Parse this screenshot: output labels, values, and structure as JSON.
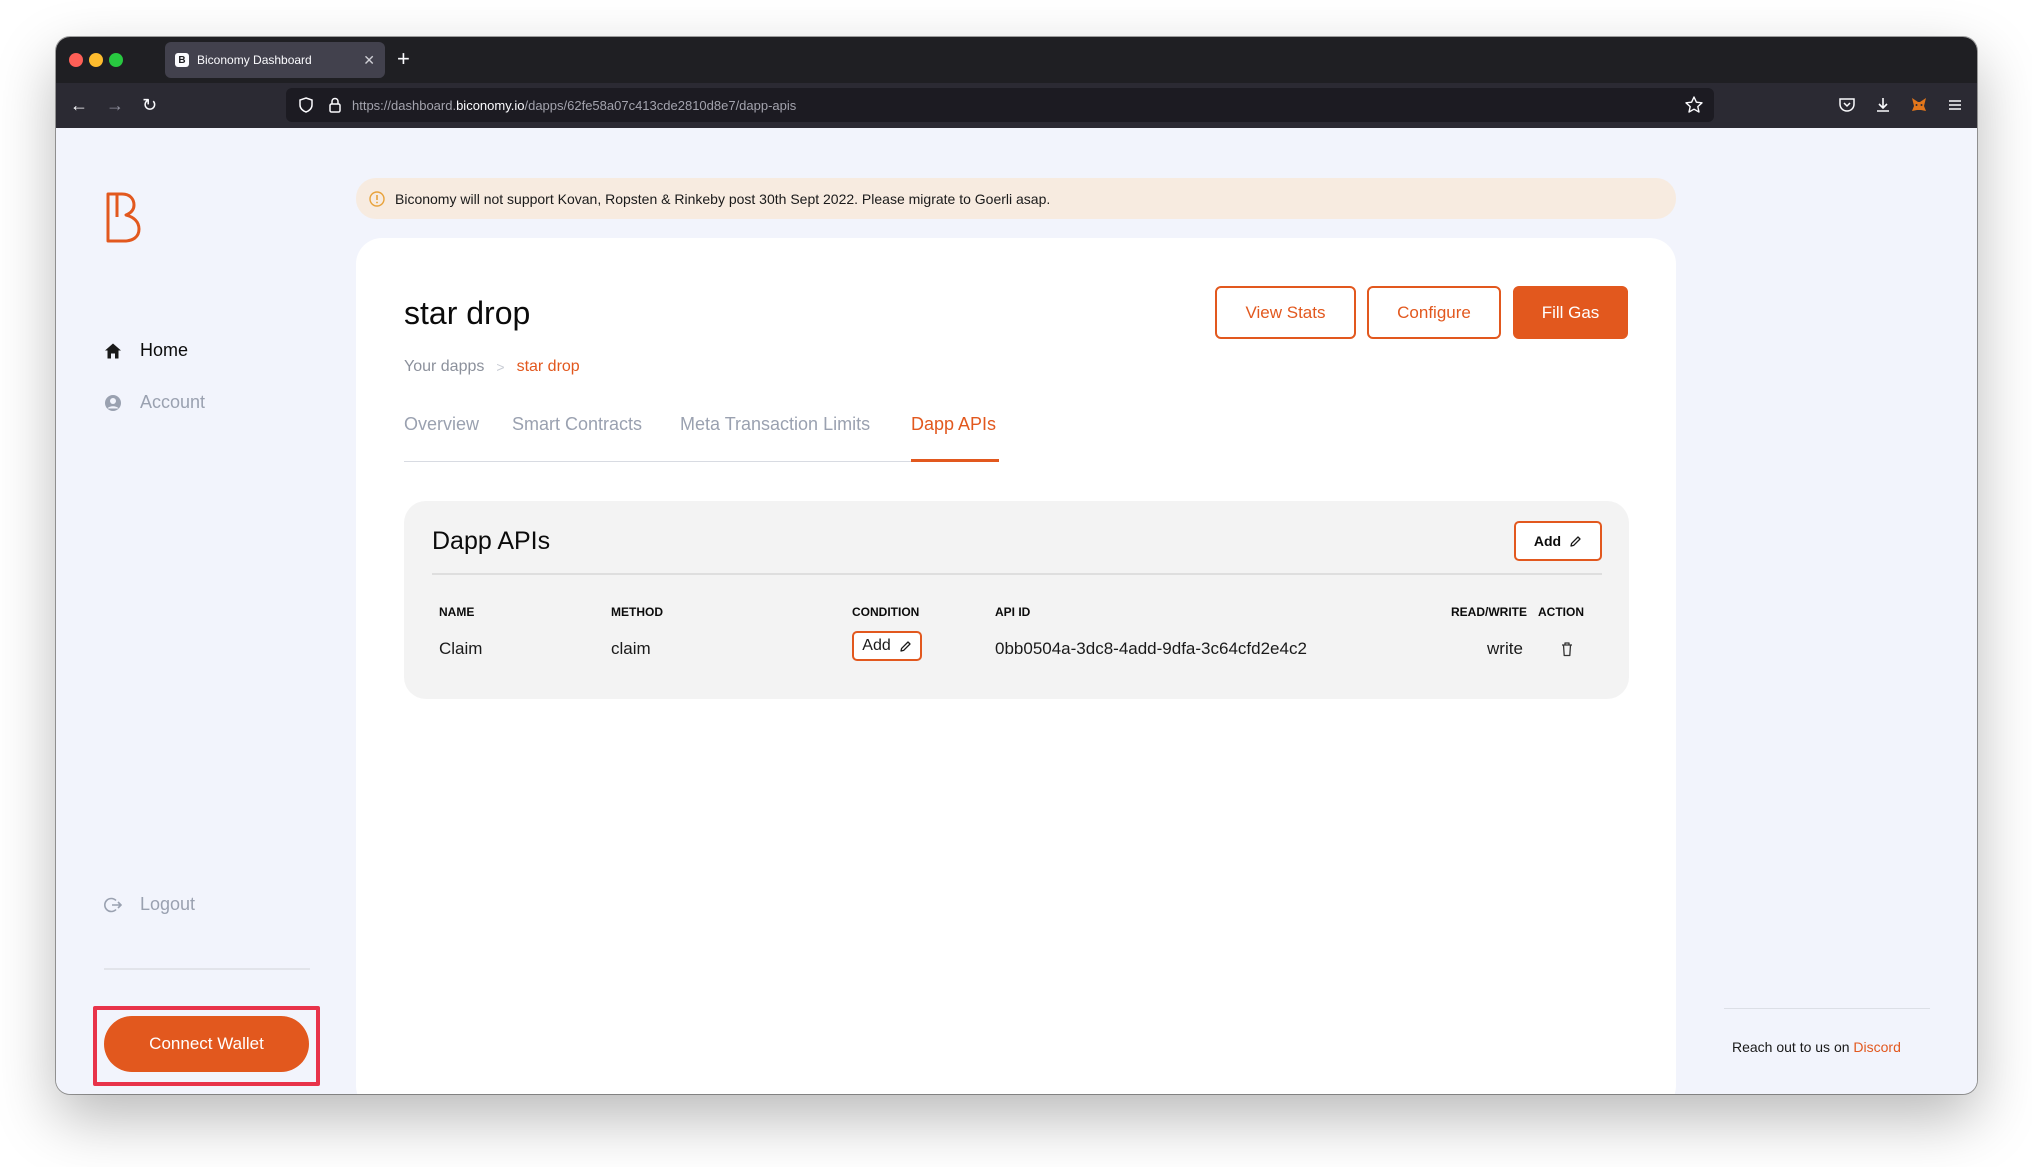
{
  "browser": {
    "tab_title": "Biconomy Dashboard",
    "tab_favicon": "B",
    "new_tab": "+",
    "url_prefix": "https://dashboard.",
    "url_domain": "biconomy.io",
    "url_path": "/dapps/62fe58a07c413cde2810d8e7/dapp-apis"
  },
  "sidebar": {
    "items": [
      {
        "label": "Home",
        "icon": "home-icon"
      },
      {
        "label": "Account",
        "icon": "account-icon"
      }
    ],
    "logout_label": "Logout",
    "connect_wallet_label": "Connect Wallet"
  },
  "banner": {
    "text": "Biconomy will not support Kovan, Ropsten & Rinkeby post 30th Sept 2022. Please migrate to Goerli asap."
  },
  "page": {
    "title": "star drop",
    "breadcrumb": {
      "root": "Your dapps",
      "separator": ">",
      "current": "star drop"
    },
    "buttons": {
      "view_stats": "View Stats",
      "configure": "Configure",
      "fill_gas": "Fill Gas"
    },
    "tabs": [
      "Overview",
      "Smart Contracts",
      "Meta Transaction Limits",
      "Dapp APIs"
    ],
    "active_tab": "Dapp APIs"
  },
  "panel": {
    "title": "Dapp APIs",
    "add_label": "Add",
    "columns": [
      "NAME",
      "METHOD",
      "CONDITION",
      "API ID",
      "READ/WRITE",
      "ACTION"
    ],
    "rows": [
      {
        "name": "Claim",
        "method": "claim",
        "condition_label": "Add",
        "api_id": "0bb0504a-3dc8-4add-9dfa-3c64cfd2e4c2",
        "read_write": "write"
      }
    ]
  },
  "help": {
    "text": "Reach out to us on ",
    "link": "Discord"
  },
  "colors": {
    "accent": "#e2581e",
    "page_bg": "#f2f4fc",
    "highlight": "#e8334a"
  }
}
